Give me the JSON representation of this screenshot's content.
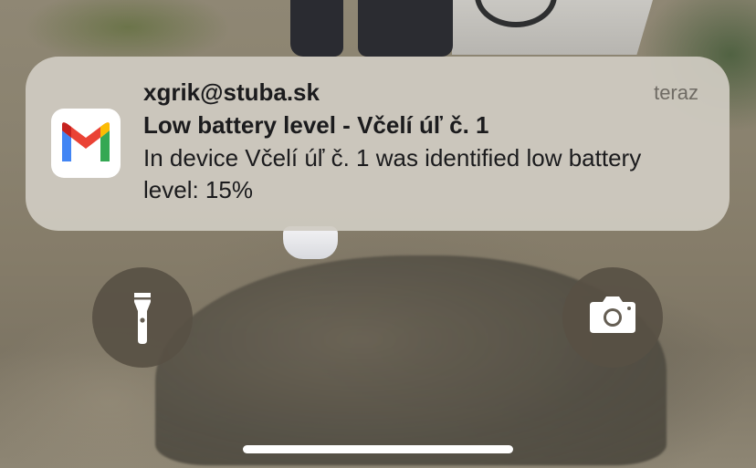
{
  "notification": {
    "app_icon": "gmail-icon",
    "sender": "xgrik@stuba.sk",
    "time": "teraz",
    "title": "Low battery level - Včelí úľ č. 1",
    "body": "In device Včelí úľ č. 1 was identified low battery level: 15%"
  },
  "lock_screen": {
    "flashlight_icon": "flashlight-icon",
    "camera_icon": "camera-icon"
  },
  "colors": {
    "gmail_red": "#EA4335",
    "gmail_blue": "#4285F4",
    "gmail_green": "#34A853",
    "gmail_yellow": "#FBBC04",
    "gmail_darkred": "#C5221F"
  }
}
